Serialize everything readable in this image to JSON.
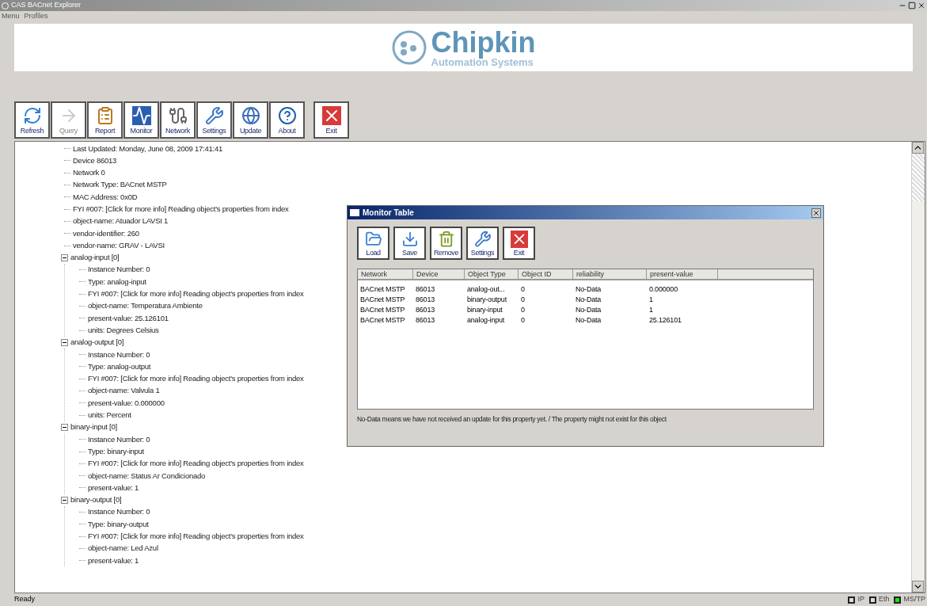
{
  "window": {
    "title": "CAS BACnet Explorer"
  },
  "menu": [
    "Menu",
    "Profiles"
  ],
  "logo": {
    "name": "Chipkin",
    "tagline": "Automation Systems"
  },
  "toolbar": [
    {
      "label": "Refresh",
      "kind": "refresh",
      "disabled": false
    },
    {
      "label": "Query",
      "kind": "query",
      "disabled": true
    },
    {
      "label": "Report",
      "kind": "report",
      "disabled": false
    },
    {
      "label": "Monitor",
      "kind": "monitor",
      "disabled": false
    },
    {
      "label": "Network",
      "kind": "network",
      "disabled": false
    },
    {
      "label": "Settings",
      "kind": "settings",
      "disabled": false
    },
    {
      "label": "Update",
      "kind": "update",
      "disabled": false
    },
    {
      "label": "About",
      "kind": "about",
      "disabled": false
    },
    {
      "label": "Exit",
      "kind": "exit",
      "disabled": false
    }
  ],
  "tree": [
    {
      "text": "Last Updated: Monday, June 08, 2009 17:41:41"
    },
    {
      "text": "Device 86013"
    },
    {
      "text": "Network 0"
    },
    {
      "text": "Network Type: BACnet MSTP"
    },
    {
      "text": "MAC Address: 0x0D"
    },
    {
      "text": "FYI #007: [Click for more info] Reading object's properties from index"
    },
    {
      "text": "object-name: Atuador LAVSI 1"
    },
    {
      "text": "vendor-identifier: 260"
    },
    {
      "text": "vendor-name: GRAV - LAVSI"
    },
    {
      "text": "analog-input [0]",
      "expanded": true,
      "children": [
        {
          "text": "Instance Number: 0"
        },
        {
          "text": "Type: analog-input"
        },
        {
          "text": "FYI #007: [Click for more info] Reading object's properties from index"
        },
        {
          "text": "object-name: Temperatura Ambiente"
        },
        {
          "text": "present-value: 25.126101"
        },
        {
          "text": "units: Degrees Celsius"
        }
      ]
    },
    {
      "text": "analog-output [0]",
      "expanded": true,
      "children": [
        {
          "text": "Instance Number: 0"
        },
        {
          "text": "Type: analog-output"
        },
        {
          "text": "FYI #007: [Click for more info] Reading object's properties from index"
        },
        {
          "text": "object-name: Valvula 1"
        },
        {
          "text": "present-value: 0.000000"
        },
        {
          "text": "units: Percent"
        }
      ]
    },
    {
      "text": "binary-input [0]",
      "expanded": true,
      "children": [
        {
          "text": "Instance Number: 0"
        },
        {
          "text": "Type: binary-input"
        },
        {
          "text": "FYI #007: [Click for more info] Reading object's properties from index"
        },
        {
          "text": "object-name: Status Ar Condicionado"
        },
        {
          "text": "present-value: 1"
        }
      ]
    },
    {
      "text": "binary-output [0]",
      "expanded": true,
      "children": [
        {
          "text": "Instance Number: 0"
        },
        {
          "text": "Type: binary-output"
        },
        {
          "text": "FYI #007: [Click for more info] Reading object's properties from index"
        },
        {
          "text": "object-name: Led Azul"
        },
        {
          "text": "present-value: 1"
        }
      ]
    }
  ],
  "monitor_table": {
    "title": "Monitor Table",
    "toolbar": [
      {
        "label": "Load",
        "kind": "load"
      },
      {
        "label": "Save",
        "kind": "save"
      },
      {
        "label": "Remove",
        "kind": "remove"
      },
      {
        "label": "Settings",
        "kind": "settings"
      },
      {
        "label": "Exit",
        "kind": "exit"
      }
    ],
    "columns": [
      "Network",
      "Device",
      "Object Type",
      "Object ID",
      "reliability",
      "present-value"
    ],
    "rows": [
      [
        "BACnet MSTP",
        "86013",
        "analog-out...",
        "0",
        "No-Data",
        "0.000000"
      ],
      [
        "BACnet MSTP",
        "86013",
        "binary-output",
        "0",
        "No-Data",
        "1"
      ],
      [
        "BACnet MSTP",
        "86013",
        "binary-input",
        "0",
        "No-Data",
        "1"
      ],
      [
        "BACnet MSTP",
        "86013",
        "analog-input",
        "0",
        "No-Data",
        "25.126101"
      ]
    ],
    "note": "No-Data means we have not received an update for this property yet. / The property might not exist for this object"
  },
  "status_bar": {
    "text": "Ready",
    "indicators": [
      {
        "label": "IP",
        "on": false
      },
      {
        "label": "Eth",
        "on": false
      },
      {
        "label": "MS/TP",
        "on": true
      }
    ]
  }
}
